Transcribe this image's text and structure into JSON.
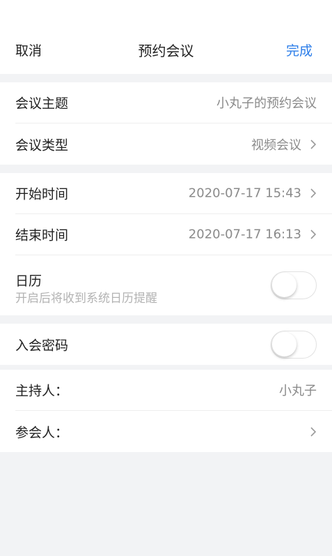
{
  "nav": {
    "cancel_label": "取消",
    "title": "预约会议",
    "done_label": "完成"
  },
  "basic": {
    "topic_label": "会议主题",
    "topic_value": "小丸子的预约会议",
    "type_label": "会议类型",
    "type_value": "视频会议"
  },
  "time": {
    "start_label": "开始时间",
    "start_value": "2020-07-17 15:43",
    "end_label": "结束时间",
    "end_value": "2020-07-17 16:13",
    "calendar_label": "日历",
    "calendar_hint": "开启后将收到系统日历提醒",
    "calendar_enabled": false
  },
  "password": {
    "label": "入会密码",
    "enabled": false
  },
  "people": {
    "host_label": "主持人：",
    "host_value": "小丸子",
    "attendees_label": "参会人："
  },
  "colors": {
    "accent": "#2b7de9",
    "background": "#f2f3f5"
  }
}
